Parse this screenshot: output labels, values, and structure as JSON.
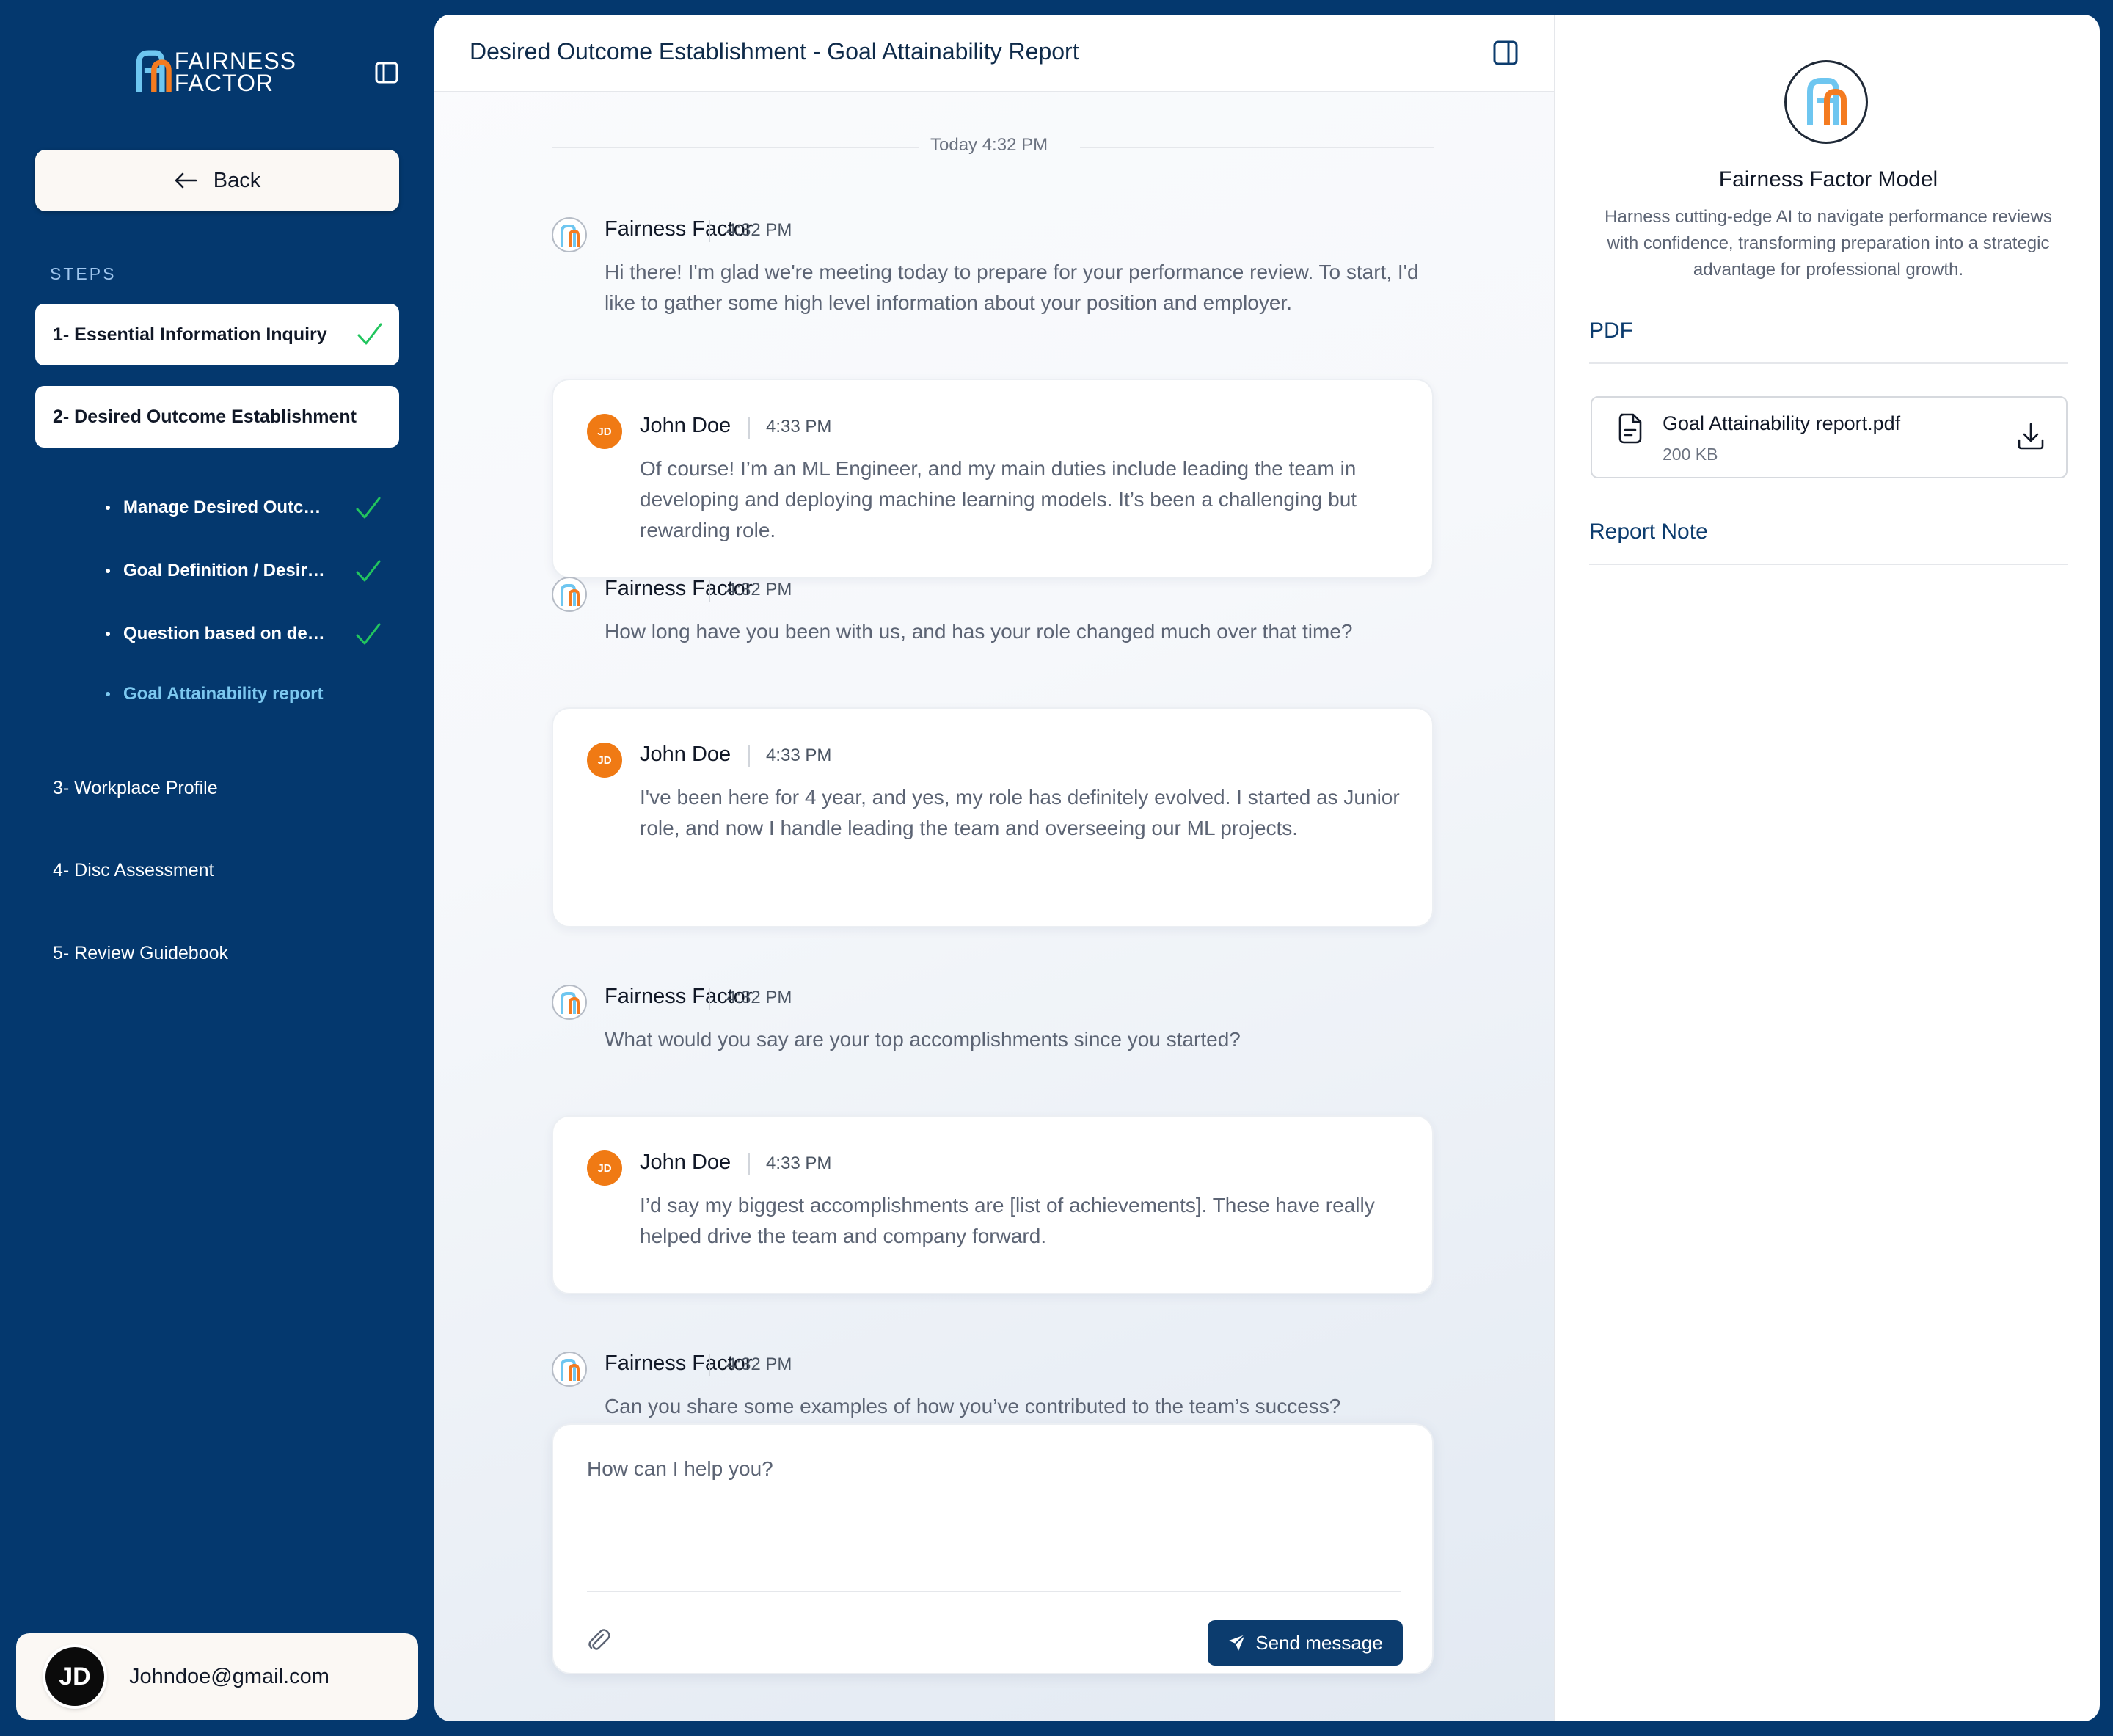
{
  "sidebar": {
    "logo_line1": "FAIRNESS",
    "logo_line2": "FACTOR",
    "back_label": "Back",
    "steps_heading": "STEPS",
    "steps": [
      {
        "label": "1- Essential Information Inquiry",
        "done": true
      },
      {
        "label": "2- Desired Outcome Establishment",
        "done": false
      },
      {
        "label": "3- Workplace Profile"
      },
      {
        "label": "4- Disc Assessment"
      },
      {
        "label": "5- Review Guidebook"
      }
    ],
    "substeps": [
      {
        "label": "Manage Desired Outcome",
        "done": true
      },
      {
        "label": "Goal Definition / Desired Outcome",
        "done": true
      },
      {
        "label": "Question based on desired outcome",
        "done": true
      },
      {
        "label": "Goal Attainability report",
        "active": true
      }
    ],
    "user_initials": "JD",
    "user_email": "Johndoe@gmail.com"
  },
  "main": {
    "title": "Desired Outcome Establishment - Goal Attainability Report",
    "date_divider": "Today 4:32 PM",
    "messages": [
      {
        "sender": "Fairness Factor",
        "time": "4:32 PM",
        "text": "Hi there! I'm glad we're meeting today to prepare for your performance review. To start, I'd like to gather some high level information about your position and employer."
      },
      {
        "sender": "John Doe",
        "initials": "JD",
        "time": "4:33 PM",
        "text": "Of course! I’m an ML Engineer, and my main duties include leading the team in developing and deploying machine learning models. It’s been a challenging but rewarding role."
      },
      {
        "sender": "Fairness Factor",
        "time": "4:32 PM",
        "text": "How long have you been with us, and has your role changed much over that time?"
      },
      {
        "sender": "John Doe",
        "initials": "JD",
        "time": "4:33 PM",
        "text": " I've been here for 4 year, and yes, my role has definitely evolved. I started as Junior role, and now I handle leading the team and overseeing our ML projects."
      },
      {
        "sender": "Fairness Factor",
        "time": "4:32 PM",
        "text": "What would you say are your top accomplishments since you started?"
      },
      {
        "sender": "John Doe",
        "initials": "JD",
        "time": "4:33 PM",
        "text": " I’d say my biggest accomplishments are [list of achievements]. These have really helped drive the team and company forward."
      },
      {
        "sender": "Fairness Factor",
        "time": "4:32 PM",
        "text": " Can you share some examples of how you’ve contributed to the team’s success?"
      }
    ],
    "composer_placeholder": "How can I help you?",
    "send_label": "Send message"
  },
  "right": {
    "model_title": "Fairness Factor Model",
    "model_desc": "Harness cutting-edge AI to navigate performance reviews with confidence, transforming preparation into a strategic advantage for professional growth.",
    "pdf_heading": "PDF",
    "file_name": "Goal Attainability report.pdf",
    "file_size": "200 KB",
    "report_note_heading": "Report Note"
  },
  "colors": {
    "sidebar_bg": "#04386e",
    "accent_blue": "#0c3c6e",
    "check_green": "#22c55e",
    "jd_orange": "#f07a14",
    "logo_blue": "#6ec6f0",
    "logo_orange": "#f47b20"
  }
}
